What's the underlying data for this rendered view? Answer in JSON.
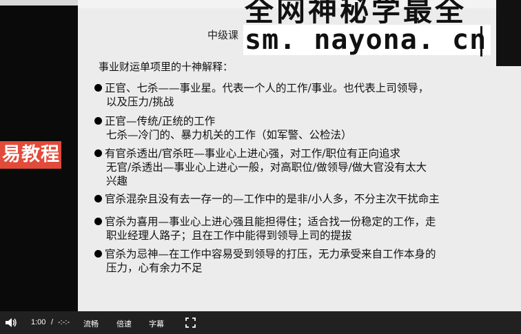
{
  "left_banner": {
    "text": "易教程",
    "color": "#e24a3a"
  },
  "watermark": {
    "top_text": "全网神秘学最全",
    "url": "sm. nayona. cn"
  },
  "slide": {
    "lesson_title": "中级课",
    "heading": "事业财运单项里的十神解释：",
    "items": [
      {
        "line1": "正官、七杀——事业星。代表一个人的工作/事业。也代表上司领导，",
        "line2": "以及压力/挑战"
      },
      {
        "line1": "正官—传统/正统的工作",
        "line2": "七杀—冷门的、暴力机关的工作（如军警、公检法）"
      },
      {
        "line1": "有官杀透出/官杀旺—事业心上进心强，对工作/职位有正向追求",
        "line2": "无官/杀透出—事业心上进心一般，对高职位/做领导/做大官没有太大",
        "line3": "兴趣"
      },
      {
        "line1": "官杀混杂且没有去一存一的—工作中的是非/小人多，不分主次干扰命主"
      },
      {
        "line1": "官杀为喜用—事业心上进心强且能担得住；适合找一份稳定的工作，走",
        "line2": "职业经理人路子；且在工作中能得到领导上司的提拔"
      },
      {
        "line1": "官杀为忌神—在工作中容易受到领导的打压，无力承受来自工作本身的",
        "line2": "压力，心有余力不足"
      }
    ]
  },
  "controls": {
    "time_current": "1:00",
    "time_separator": "/",
    "time_total": "-:-:-",
    "quality_label": "流畅",
    "speed_label": "倍速",
    "subtitle_label": "字幕"
  }
}
